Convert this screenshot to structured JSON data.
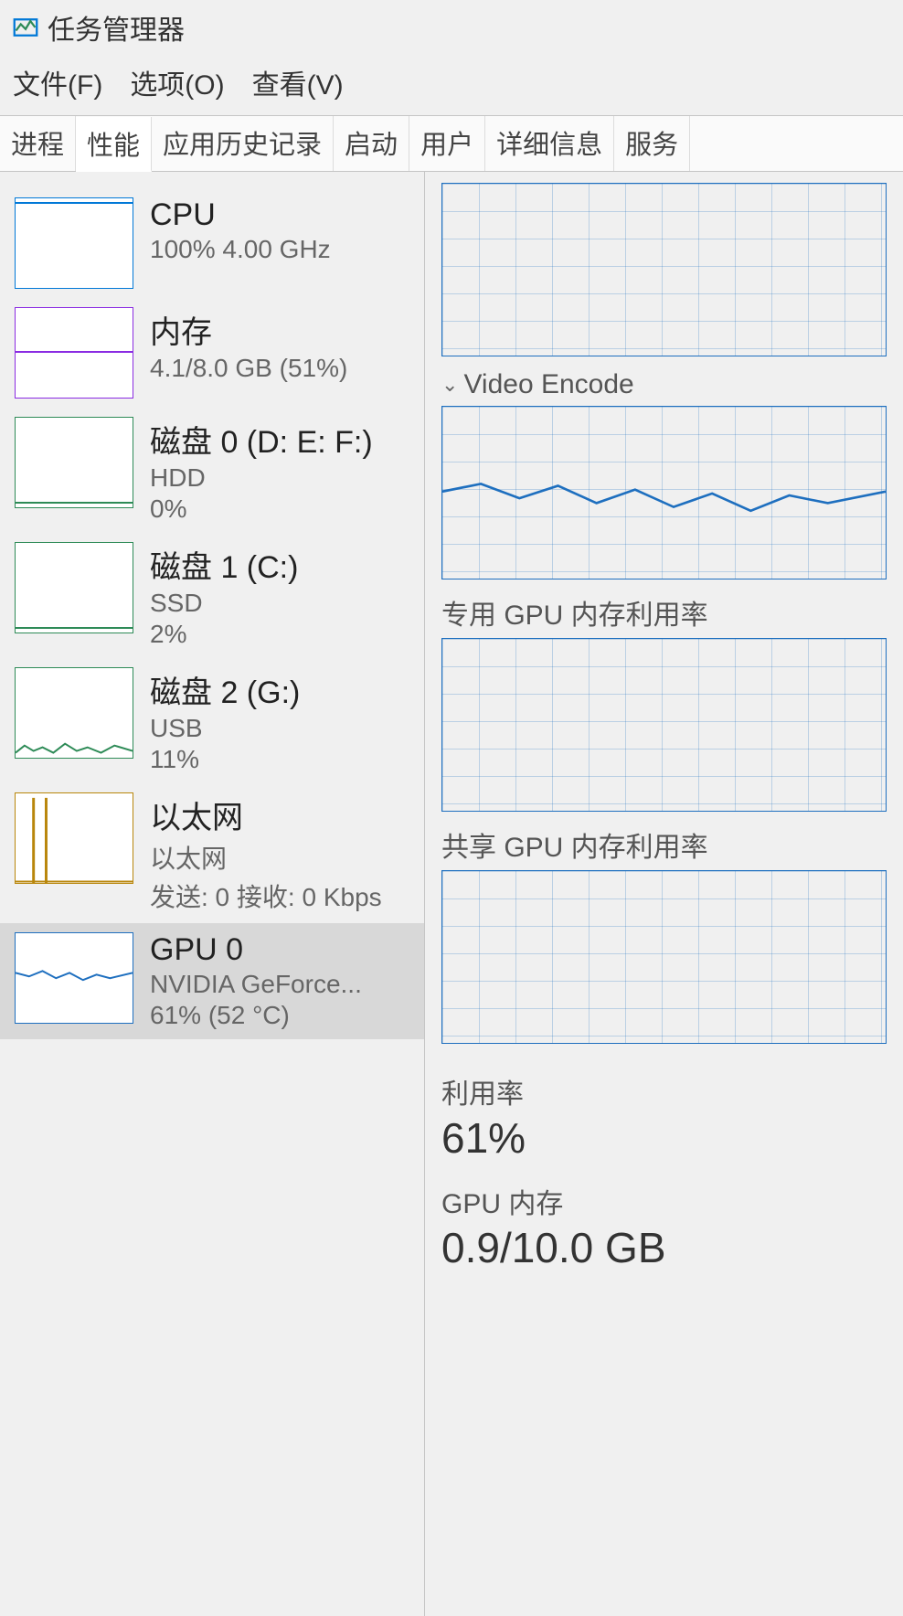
{
  "window": {
    "title": "任务管理器"
  },
  "menu": {
    "file": "文件(F)",
    "options": "选项(O)",
    "view": "查看(V)"
  },
  "tabs": {
    "processes": "进程",
    "performance": "性能",
    "app_history": "应用历史记录",
    "startup": "启动",
    "users": "用户",
    "details": "详细信息",
    "services": "服务",
    "active": "performance"
  },
  "sidebar": {
    "cpu": {
      "title": "CPU",
      "sub": "100% 4.00 GHz"
    },
    "memory": {
      "title": "内存",
      "sub": "4.1/8.0 GB (51%)"
    },
    "disk0": {
      "title": "磁盘 0 (D: E: F:)",
      "type": "HDD",
      "pct": "0%"
    },
    "disk1": {
      "title": "磁盘 1 (C:)",
      "type": "SSD",
      "pct": "2%"
    },
    "disk2": {
      "title": "磁盘 2 (G:)",
      "type": "USB",
      "pct": "11%"
    },
    "ethernet": {
      "title": "以太网",
      "iface": "以太网",
      "net": "发送: 0 接收: 0 Kbps"
    },
    "gpu0": {
      "title": "GPU 0",
      "name": "NVIDIA GeForce...",
      "stat": "61% (52 °C)"
    }
  },
  "detail": {
    "section_video_encode": "Video Encode",
    "section_dedicated_mem": "专用 GPU 内存利用率",
    "section_shared_mem": "共享 GPU 内存利用率",
    "util_label": "利用率",
    "util_value": "61%",
    "mem_label": "GPU 内存",
    "mem_value": "0.9/10.0 GB"
  },
  "colors": {
    "cpu": "#0078d7",
    "mem": "#8a2be2",
    "disk": "#2e8b57",
    "eth": "#b8860b",
    "gpu": "#1e6fbf"
  }
}
